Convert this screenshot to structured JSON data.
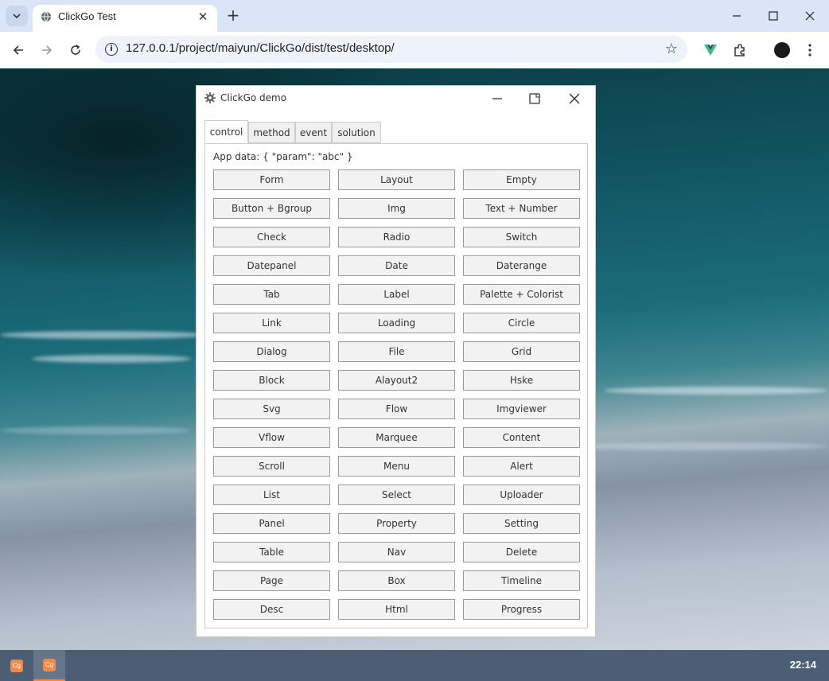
{
  "browser": {
    "tab_title": "ClickGo Test",
    "url": "127.0.0.1/project/maiyun/ClickGo/dist/test/desktop/"
  },
  "app_window": {
    "title": "ClickGo demo",
    "tabs": [
      {
        "label": "control",
        "active": true
      },
      {
        "label": "method",
        "active": false
      },
      {
        "label": "event",
        "active": false
      },
      {
        "label": "solution",
        "active": false
      }
    ],
    "app_data_text": "App data: { \"param\": \"abc\" }",
    "buttons": [
      "Form",
      "Layout",
      "Empty",
      "Button + Bgroup",
      "Img",
      "Text + Number",
      "Check",
      "Radio",
      "Switch",
      "Datepanel",
      "Date",
      "Daterange",
      "Tab",
      "Label",
      "Palette + Colorist",
      "Link",
      "Loading",
      "Circle",
      "Dialog",
      "File",
      "Grid",
      "Block",
      "Alayout2",
      "Hske",
      "Svg",
      "Flow",
      "Imgviewer",
      "Vflow",
      "Marquee",
      "Content",
      "Scroll",
      "Menu",
      "Alert",
      "List",
      "Select",
      "Uploader",
      "Panel",
      "Property",
      "Setting",
      "Table",
      "Nav",
      "Delete",
      "Page",
      "Box",
      "Timeline",
      "Desc",
      "Html",
      "Progress"
    ]
  },
  "taskbar": {
    "apps": [
      {
        "icon_text": "Cg",
        "active": false
      },
      {
        "icon_text": "Cg",
        "active": true
      }
    ],
    "clock": "22:14"
  },
  "colors": {
    "accent": "#f08a4b",
    "taskbar": "#4c5e74"
  }
}
